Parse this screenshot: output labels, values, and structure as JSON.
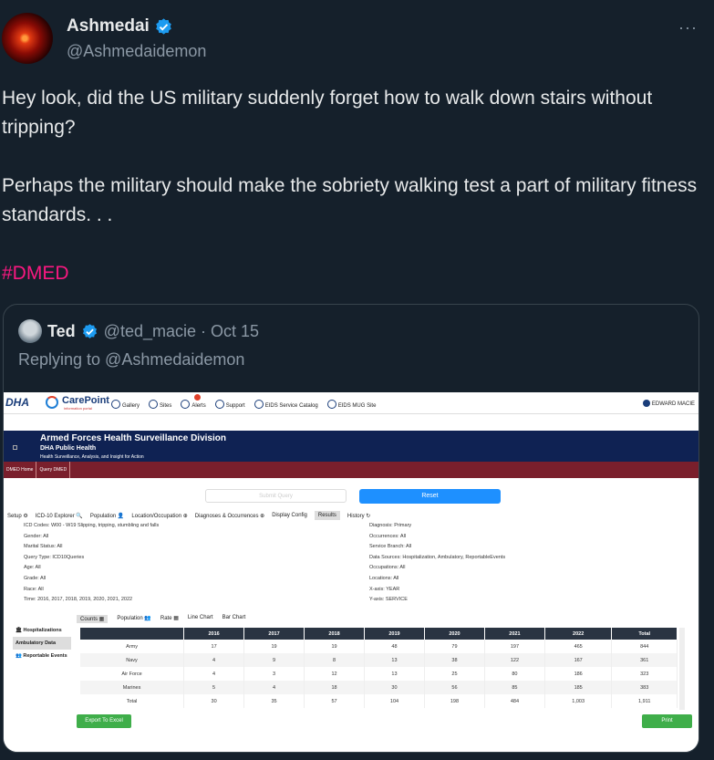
{
  "author": {
    "name": "Ashmedai",
    "handle": "@Ashmedaidemon"
  },
  "more_label": "···",
  "tweet": {
    "paragraph1": "Hey look, did the US military suddenly forget how to walk down stairs without tripping?",
    "paragraph2": "Perhaps the military should make the sobriety walking test a part of military fitness standards. . .",
    "hashtag": "#DMED"
  },
  "quote": {
    "name": "Ted",
    "handle_date": "@ted_macie · Oct 15",
    "replying": "Replying to @Ashmedaidemon"
  },
  "screenshot": {
    "logo_dha": "DHA",
    "logo_carepoint": "CarePoint",
    "logo_carepoint_sub": "information portal",
    "nav": [
      "Gallery",
      "Sites",
      "Alerts",
      "Support",
      "EIDS Service Catalog",
      "EIDS MUG Site"
    ],
    "user": "EDWARD MACIE",
    "banner_title": "Armed Forces Health Surveillance Division",
    "banner_sub": "DHA Public Health",
    "banner_tag": "Health Surveillance, Analysis, and Insight for Action",
    "maroon_tabs": [
      "DMED Home",
      "Query DMED"
    ],
    "submit": "Submit Query",
    "reset": "Reset",
    "tabs": [
      "Setup ⚙",
      "ICD-10 Explorer 🔍",
      "Population 👤",
      "Location/Occupation ⊕",
      "Diagnoses & Occurrences ⊕",
      "Display Config",
      "Results",
      "History ↻"
    ],
    "left_info": [
      "ICD Codes: W00 - W19 Slipping, tripping, stumbling and falls",
      "Gender: All",
      "Marital Status: All",
      "Query Type: ICD10Queries",
      "Age: All",
      "Grade: All",
      "Race: All",
      "Time: 2016, 2017, 2018, 2019, 2020, 2021, 2022"
    ],
    "right_info": [
      "Diagnosis: Primary",
      "Occurrences: All",
      "Service Branch: All",
      "Data Sources: Hospitalization, Ambulatory, ReportableEvents",
      "Occupations: All",
      "Locations: All",
      "X-axis: YEAR",
      "Y-axis: SERVICE"
    ],
    "subtabs": [
      "Counts ▦",
      "Population 👥",
      "Rate ▦",
      "Line Chart",
      "Bar Chart"
    ],
    "left_panel": [
      "🏛 Hospitalizations",
      "Ambulatory Data",
      "👥 Reportable Events"
    ],
    "table_headers": [
      "",
      "2016",
      "2017",
      "2018",
      "2019",
      "2020",
      "2021",
      "2022",
      "Total"
    ],
    "table_rows": [
      [
        "Army",
        "17",
        "19",
        "19",
        "48",
        "79",
        "197",
        "465",
        "844"
      ],
      [
        "Navy",
        "4",
        "9",
        "8",
        "13",
        "38",
        "122",
        "167",
        "361"
      ],
      [
        "Air Force",
        "4",
        "3",
        "12",
        "13",
        "25",
        "80",
        "186",
        "323"
      ],
      [
        "Marines",
        "5",
        "4",
        "18",
        "30",
        "56",
        "85",
        "185",
        "383"
      ],
      [
        "Total",
        "30",
        "35",
        "57",
        "104",
        "198",
        "484",
        "1,003",
        "1,911"
      ]
    ],
    "export": "Export To Excel",
    "print": "Print"
  }
}
